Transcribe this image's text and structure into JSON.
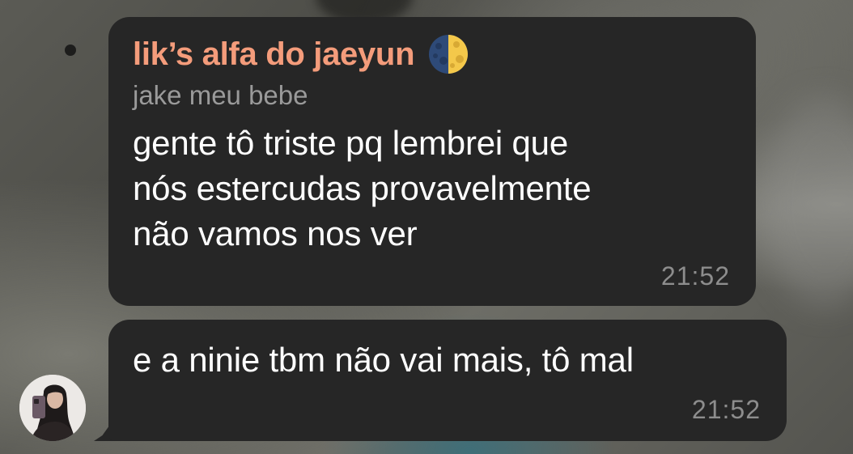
{
  "chat": {
    "messages": [
      {
        "sender": "lik’s alfa do jaeyun",
        "sender_emoji": "moon-icon",
        "reply_to": "jake meu bebe",
        "text": "gente tô triste pq lembrei que\nnós estercudas provavelmente\nnão vamos nos ver",
        "time": "21:52"
      },
      {
        "text": "e a ninie tbm não vai mais, tô mal",
        "time": "21:52"
      }
    ]
  },
  "colors": {
    "bubble": "#262626",
    "sender_name": "#f49c7b",
    "reply_name": "#9a9a9a",
    "timestamp": "#8d8d8d",
    "message_text": "#ffffff"
  }
}
